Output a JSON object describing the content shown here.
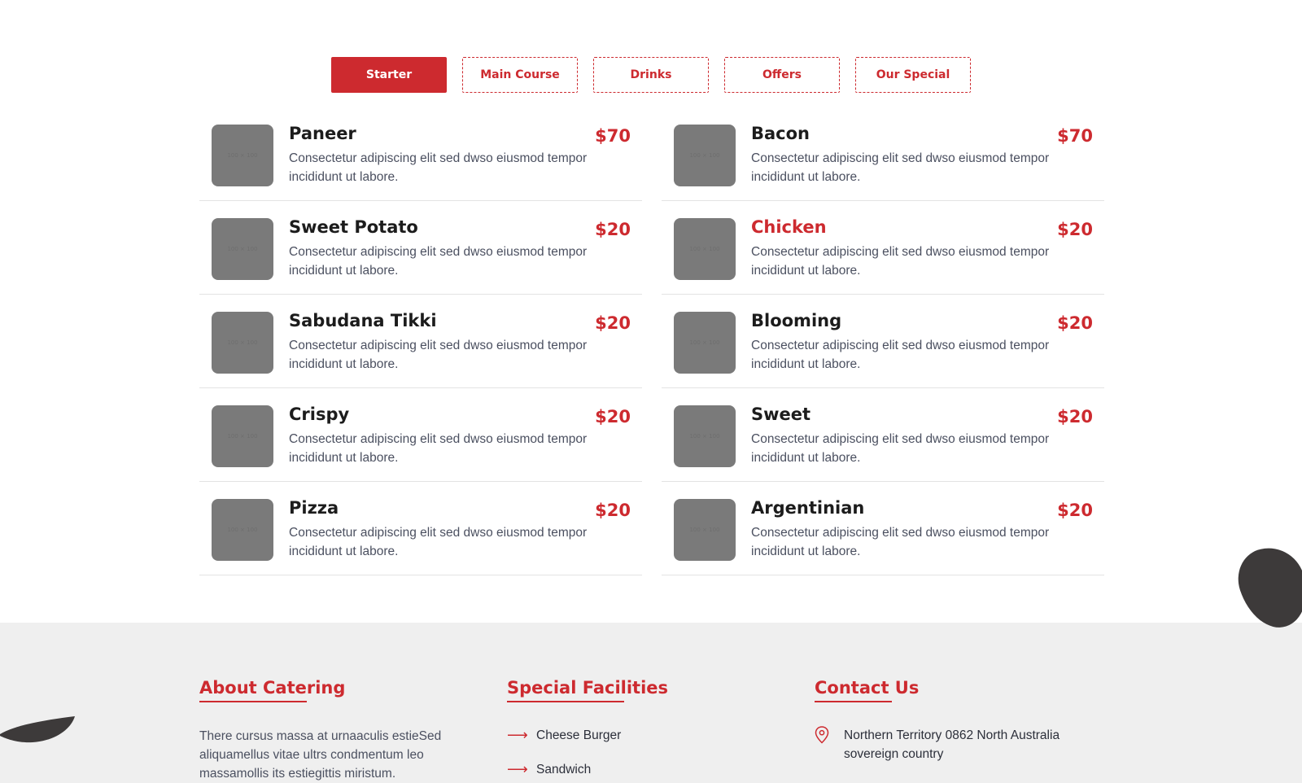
{
  "tabs": [
    {
      "label": "Starter",
      "active": true
    },
    {
      "label": "Main Course"
    },
    {
      "label": "Drinks"
    },
    {
      "label": "Offers"
    },
    {
      "label": "Our Special"
    }
  ],
  "thumb_placeholder": "100 × 100",
  "menu_left": [
    {
      "name": "Paneer",
      "desc": "Consectetur adipiscing elit sed dwso eiusmod tempor incididunt ut labore.",
      "price": "$70"
    },
    {
      "name": "Sweet Potato",
      "desc": "Consectetur adipiscing elit sed dwso eiusmod tempor incididunt ut labore.",
      "price": "$20"
    },
    {
      "name": "Sabudana Tikki",
      "desc": "Consectetur adipiscing elit sed dwso eiusmod tempor incididunt ut labore.",
      "price": "$20"
    },
    {
      "name": "Crispy",
      "desc": "Consectetur adipiscing elit sed dwso eiusmod tempor incididunt ut labore.",
      "price": "$20"
    },
    {
      "name": "Pizza",
      "desc": "Consectetur adipiscing elit sed dwso eiusmod tempor incididunt ut labore.",
      "price": "$20"
    }
  ],
  "menu_right": [
    {
      "name": "Bacon",
      "desc": "Consectetur adipiscing elit sed dwso eiusmod tempor incididunt ut labore.",
      "price": "$70"
    },
    {
      "name": "Chicken",
      "desc": "Consectetur adipiscing elit sed dwso eiusmod tempor incididunt ut labore.",
      "price": "$20",
      "highlight": true
    },
    {
      "name": "Blooming",
      "desc": "Consectetur adipiscing elit sed dwso eiusmod tempor incididunt ut labore.",
      "price": "$20"
    },
    {
      "name": "Sweet",
      "desc": "Consectetur adipiscing elit sed dwso eiusmod tempor incididunt ut labore.",
      "price": "$20"
    },
    {
      "name": "Argentinian",
      "desc": "Consectetur adipiscing elit sed dwso eiusmod tempor incididunt ut labore.",
      "price": "$20"
    }
  ],
  "footer": {
    "about": {
      "title": "About Catering",
      "text": "There cursus massa at urnaaculis estieSed aliquamellus vitae ultrs condmentum leo massamollis its estiegittis miristum."
    },
    "facilities": {
      "title": "Special Facilities",
      "items": [
        "Cheese Burger",
        "Sandwich"
      ]
    },
    "contact": {
      "title": "Contact Us",
      "address": "Northern Territory 0862 North Australia sovereign country"
    }
  },
  "colors": {
    "accent": "#cd2a2f",
    "footer_bg": "#efefef",
    "thumb": "#7a7a7a"
  },
  "icons": {
    "arrow": "right-arrow-icon",
    "pin": "map-pin-icon"
  }
}
